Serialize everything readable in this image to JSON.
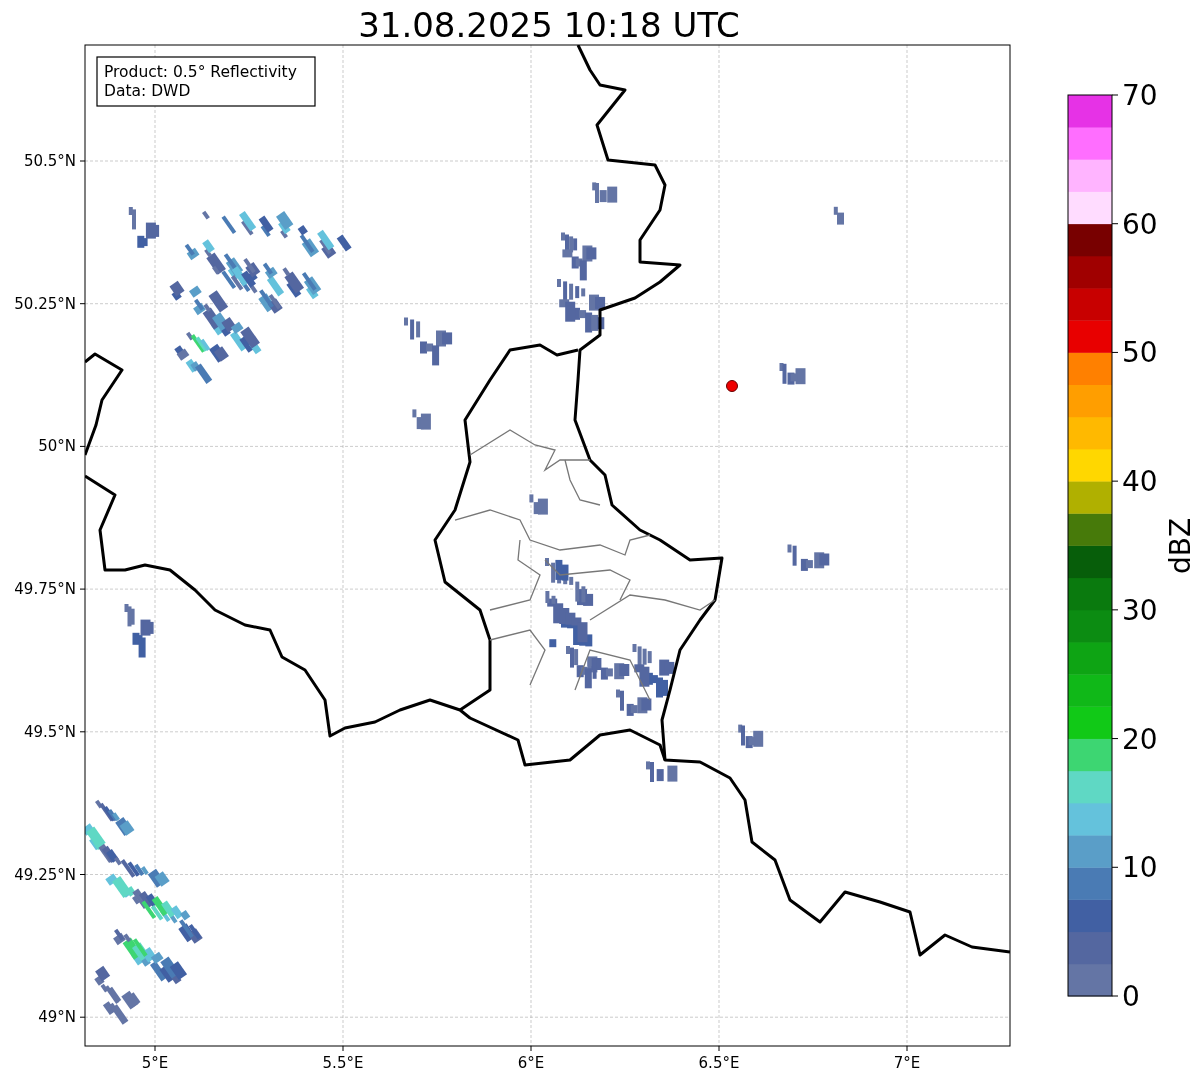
{
  "title": "31.08.2025 10:18 UTC",
  "info_box": [
    "Product: 0.5° Reflectivity",
    "Data: DWD"
  ],
  "x_ticks": [
    "5°E",
    "5.5°E",
    "6°E",
    "6.5°E",
    "7°E"
  ],
  "y_ticks": [
    "50.5°N",
    "50.25°N",
    "50°N",
    "49.75°N",
    "49.5°N",
    "49.25°N",
    "49°N"
  ],
  "colorbar": {
    "label": "dBZ",
    "ticks": [
      "70",
      "60",
      "50",
      "40",
      "30",
      "20",
      "10",
      "0"
    ],
    "bins": [
      {
        "color": "#6475a5"
      },
      {
        "color": "#5467a0"
      },
      {
        "color": "#4160a3"
      },
      {
        "color": "#4a7bb4"
      },
      {
        "color": "#5a9ec8"
      },
      {
        "color": "#64c2dc"
      },
      {
        "color": "#5fd8c4"
      },
      {
        "color": "#3dd672"
      },
      {
        "color": "#11c917"
      },
      {
        "color": "#10b818"
      },
      {
        "color": "#0ea414"
      },
      {
        "color": "#0c8c12"
      },
      {
        "color": "#0a7a0e"
      },
      {
        "color": "#075e0a"
      },
      {
        "color": "#477a0a"
      },
      {
        "color": "#b0b000"
      },
      {
        "color": "#ffd700"
      },
      {
        "color": "#ffb900"
      },
      {
        "color": "#ff9e00"
      },
      {
        "color": "#ff8000"
      },
      {
        "color": "#e80000"
      },
      {
        "color": "#c80000"
      },
      {
        "color": "#a00000"
      },
      {
        "color": "#780000"
      },
      {
        "color": "#ffdcff"
      },
      {
        "color": "#ffb4ff"
      },
      {
        "color": "#ff6eff"
      },
      {
        "color": "#e632e6"
      }
    ]
  }
}
